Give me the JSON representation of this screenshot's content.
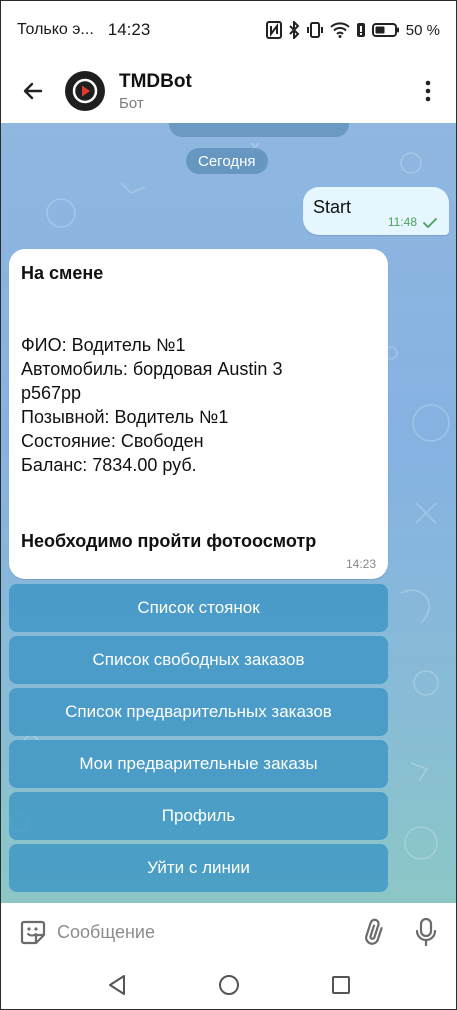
{
  "status_bar": {
    "carrier": "Только э...",
    "time": "14:23",
    "battery": "50 %"
  },
  "header": {
    "title": "TMDBot",
    "subtitle": "Бот",
    "back_icon": "arrow-left-icon",
    "menu_icon": "more-vertical-icon",
    "avatar_color": "#1f1f1f",
    "avatar_accent": "#e53935"
  },
  "chat": {
    "date_chip": "Сегодня",
    "outgoing": {
      "text": "Start",
      "time": "11:48"
    },
    "incoming": {
      "title": "На смене",
      "lines": [
        "ФИО: Водитель №1",
        "Автомобиль: бордовая Austin 3",
        "р567рр",
        "Позывной: Водитель №1",
        "Состояние: Свободен",
        "Баланс: 7834.00 руб."
      ],
      "footer": "Необходимо пройти фотоосмотр",
      "time": "14:23"
    },
    "keyboard": [
      "Список стоянок",
      "Список свободных заказов",
      "Список предварительных заказов",
      "Мои предварительные заказы",
      "Профиль",
      "Уйти с линии"
    ]
  },
  "composer": {
    "placeholder": "Сообщение",
    "sticker_icon": "sticker-icon",
    "attach_icon": "paperclip-icon",
    "mic_icon": "microphone-icon"
  },
  "nav": {
    "back_icon": "nav-back-icon",
    "home_icon": "nav-home-icon",
    "recents_icon": "nav-recents-icon"
  },
  "colors": {
    "keyboard_button": "#3a94c4",
    "outgoing_bubble": "#e6f6ff",
    "check": "#4aa05a"
  }
}
